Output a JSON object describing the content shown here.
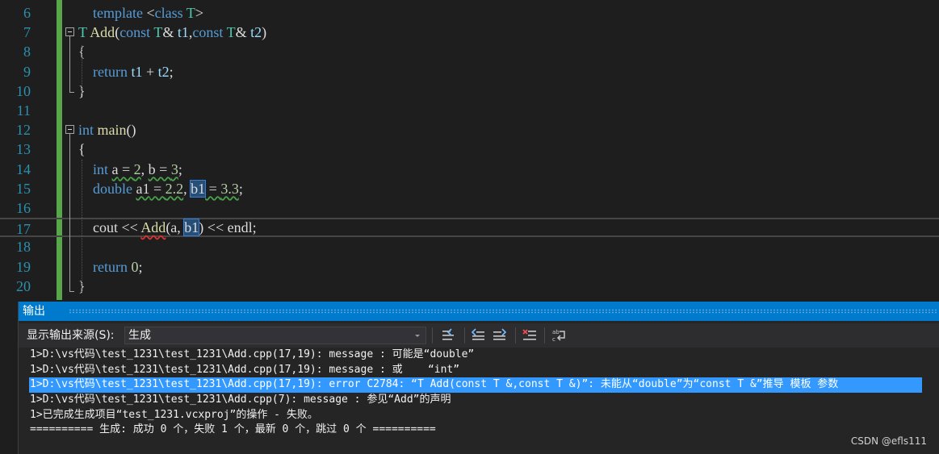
{
  "editor": {
    "lines": [
      {
        "no": "6",
        "parts": [
          [
            "",
            "    "
          ],
          [
            "kw",
            "template"
          ],
          [
            "",
            " <"
          ],
          [
            "kw",
            "class"
          ],
          [
            "",
            " "
          ],
          [
            "tp",
            "T"
          ],
          [
            "",
            ">"
          ]
        ]
      },
      {
        "no": "7",
        "parts": [
          [
            "tp",
            "T"
          ],
          [
            "",
            " "
          ],
          [
            "fn",
            "Add"
          ],
          [
            "",
            "("
          ],
          [
            "kw",
            "const"
          ],
          [
            "",
            " "
          ],
          [
            "tp",
            "T"
          ],
          [
            "",
            "& "
          ],
          [
            "pr",
            "t1"
          ],
          [
            "",
            ","
          ],
          [
            "kw",
            "const"
          ],
          [
            "",
            " "
          ],
          [
            "tp",
            "T"
          ],
          [
            "",
            "& "
          ],
          [
            "pr",
            "t2"
          ],
          [
            "",
            ")"
          ]
        ]
      },
      {
        "no": "8",
        "parts": [
          [
            "",
            "{"
          ]
        ]
      },
      {
        "no": "9",
        "parts": [
          [
            "",
            "    "
          ],
          [
            "kw",
            "return"
          ],
          [
            "",
            " "
          ],
          [
            "pr",
            "t1"
          ],
          [
            "",
            " + "
          ],
          [
            "pr",
            "t2"
          ],
          [
            "",
            ";"
          ]
        ]
      },
      {
        "no": "10",
        "parts": [
          [
            "",
            "}"
          ]
        ]
      },
      {
        "no": "11",
        "parts": []
      },
      {
        "no": "12",
        "parts": [
          [
            "kw",
            "int"
          ],
          [
            "",
            " "
          ],
          [
            "fn",
            "main"
          ],
          [
            "",
            "()"
          ]
        ]
      },
      {
        "no": "13",
        "parts": [
          [
            "",
            "{"
          ]
        ]
      },
      {
        "no": "14",
        "parts": [
          [
            "",
            "    "
          ],
          [
            "kw",
            "int"
          ],
          [
            "",
            " "
          ],
          [
            "sq",
            "a"
          ],
          [
            "sq",
            " = "
          ],
          [
            "sq nm",
            "2"
          ],
          [
            "",
            ", "
          ],
          [
            "sq",
            "b"
          ],
          [
            "sq",
            " = "
          ],
          [
            "sq nm",
            "3"
          ],
          [
            "",
            ";"
          ]
        ]
      },
      {
        "no": "15",
        "parts": [
          [
            "",
            "    "
          ],
          [
            "kw",
            "double"
          ],
          [
            "",
            " "
          ],
          [
            "sq",
            "a1"
          ],
          [
            "sq",
            " = "
          ],
          [
            "sq nm",
            "2.2"
          ],
          [
            "",
            ", "
          ],
          [
            "hl",
            "b1"
          ],
          [
            "sq",
            " = "
          ],
          [
            "sq nm",
            "3.3"
          ],
          [
            "",
            ";"
          ]
        ]
      },
      {
        "no": "16",
        "parts": []
      },
      {
        "no": "17",
        "parts": [
          [
            "",
            "    cout << "
          ],
          [
            "fn sq-red",
            "Add"
          ],
          [
            "",
            "(a, "
          ],
          [
            "hl",
            "b1"
          ],
          [
            "",
            ") << endl;"
          ]
        ]
      },
      {
        "no": "18",
        "parts": []
      },
      {
        "no": "19",
        "parts": [
          [
            "",
            "    "
          ],
          [
            "kw",
            "return"
          ],
          [
            "",
            " "
          ],
          [
            "nm",
            "0"
          ],
          [
            "",
            ";"
          ]
        ]
      },
      {
        "no": "20",
        "parts": [
          [
            "",
            "}"
          ]
        ]
      }
    ],
    "current_line": "17"
  },
  "output": {
    "title": "输出",
    "source_label": "显示输出来源(S):",
    "source_value": "生成",
    "tools": [
      "go-to-previous-message-icon",
      "find-previous-icon",
      "find-next-icon",
      "clear-all-icon",
      "toggle-word-wrap-icon"
    ],
    "lines": [
      "1>D:\\vs代码\\test_1231\\test_1231\\Add.cpp(17,19): message : 可能是“double”",
      "1>D:\\vs代码\\test_1231\\test_1231\\Add.cpp(17,19): message : 或    “int”",
      "1>D:\\vs代码\\test_1231\\test_1231\\Add.cpp(17,19): error C2784: “T Add(const T &,const T &)”: 未能从“double”为“const T &”推导 模板 参数",
      "1>D:\\vs代码\\test_1231\\test_1231\\Add.cpp(7): message : 参见“Add”的声明",
      "1>已完成生成项目“test_1231.vcxproj”的操作 - 失败。",
      "========== 生成: 成功 0 个，失败 1 个，最新 0 个，跳过 0 个 =========="
    ],
    "selected_line_index": 2
  },
  "watermark": "CSDN @efls111",
  "colors": {
    "editor_bg": "#1e1e1e",
    "keyword": "#569cd6",
    "type": "#4ec9b0",
    "function": "#dcdcaa",
    "param": "#9cdcfe",
    "number": "#b5cea8",
    "line_number": "#2b91af",
    "accent": "#007acc",
    "selection": "#3399ff"
  }
}
